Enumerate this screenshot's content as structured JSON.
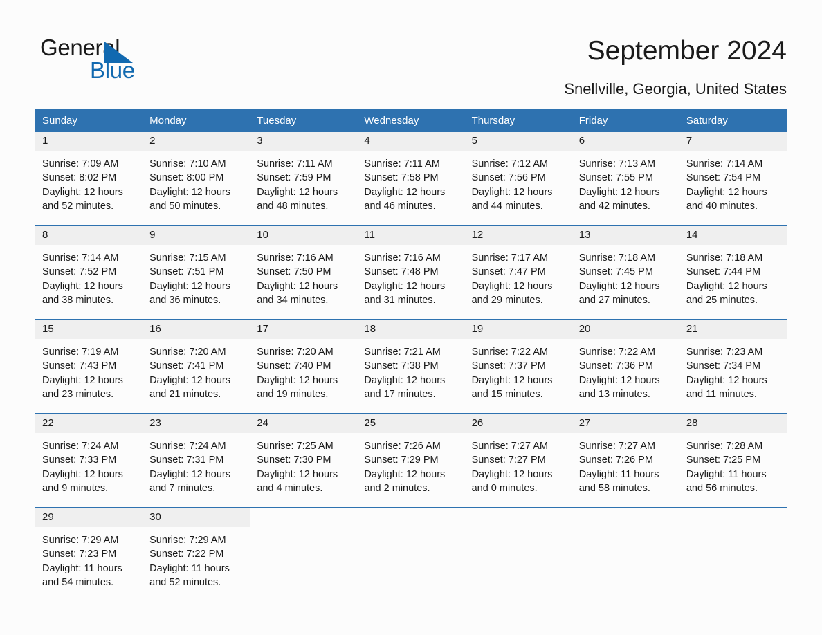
{
  "logo": {
    "word_one": "General",
    "word_two": "Blue",
    "triangle_color": "#1169b0",
    "text_color": "#1a1a1a"
  },
  "header": {
    "month_title": "September 2024",
    "location": "Snellville, Georgia, United States"
  },
  "theme": {
    "header_blue": "#2e72b0",
    "daynum_band": "#efefef",
    "page_background": "#fcfcfc",
    "text": "#1a1a1a"
  },
  "weekday_headers": [
    "Sunday",
    "Monday",
    "Tuesday",
    "Wednesday",
    "Thursday",
    "Friday",
    "Saturday"
  ],
  "weeks": [
    [
      {
        "day": "1",
        "sunrise": "Sunrise: 7:09 AM",
        "sunset": "Sunset: 8:02 PM",
        "daylight_line1": "Daylight: 12 hours",
        "daylight_line2": "and 52 minutes."
      },
      {
        "day": "2",
        "sunrise": "Sunrise: 7:10 AM",
        "sunset": "Sunset: 8:00 PM",
        "daylight_line1": "Daylight: 12 hours",
        "daylight_line2": "and 50 minutes."
      },
      {
        "day": "3",
        "sunrise": "Sunrise: 7:11 AM",
        "sunset": "Sunset: 7:59 PM",
        "daylight_line1": "Daylight: 12 hours",
        "daylight_line2": "and 48 minutes."
      },
      {
        "day": "4",
        "sunrise": "Sunrise: 7:11 AM",
        "sunset": "Sunset: 7:58 PM",
        "daylight_line1": "Daylight: 12 hours",
        "daylight_line2": "and 46 minutes."
      },
      {
        "day": "5",
        "sunrise": "Sunrise: 7:12 AM",
        "sunset": "Sunset: 7:56 PM",
        "daylight_line1": "Daylight: 12 hours",
        "daylight_line2": "and 44 minutes."
      },
      {
        "day": "6",
        "sunrise": "Sunrise: 7:13 AM",
        "sunset": "Sunset: 7:55 PM",
        "daylight_line1": "Daylight: 12 hours",
        "daylight_line2": "and 42 minutes."
      },
      {
        "day": "7",
        "sunrise": "Sunrise: 7:14 AM",
        "sunset": "Sunset: 7:54 PM",
        "daylight_line1": "Daylight: 12 hours",
        "daylight_line2": "and 40 minutes."
      }
    ],
    [
      {
        "day": "8",
        "sunrise": "Sunrise: 7:14 AM",
        "sunset": "Sunset: 7:52 PM",
        "daylight_line1": "Daylight: 12 hours",
        "daylight_line2": "and 38 minutes."
      },
      {
        "day": "9",
        "sunrise": "Sunrise: 7:15 AM",
        "sunset": "Sunset: 7:51 PM",
        "daylight_line1": "Daylight: 12 hours",
        "daylight_line2": "and 36 minutes."
      },
      {
        "day": "10",
        "sunrise": "Sunrise: 7:16 AM",
        "sunset": "Sunset: 7:50 PM",
        "daylight_line1": "Daylight: 12 hours",
        "daylight_line2": "and 34 minutes."
      },
      {
        "day": "11",
        "sunrise": "Sunrise: 7:16 AM",
        "sunset": "Sunset: 7:48 PM",
        "daylight_line1": "Daylight: 12 hours",
        "daylight_line2": "and 31 minutes."
      },
      {
        "day": "12",
        "sunrise": "Sunrise: 7:17 AM",
        "sunset": "Sunset: 7:47 PM",
        "daylight_line1": "Daylight: 12 hours",
        "daylight_line2": "and 29 minutes."
      },
      {
        "day": "13",
        "sunrise": "Sunrise: 7:18 AM",
        "sunset": "Sunset: 7:45 PM",
        "daylight_line1": "Daylight: 12 hours",
        "daylight_line2": "and 27 minutes."
      },
      {
        "day": "14",
        "sunrise": "Sunrise: 7:18 AM",
        "sunset": "Sunset: 7:44 PM",
        "daylight_line1": "Daylight: 12 hours",
        "daylight_line2": "and 25 minutes."
      }
    ],
    [
      {
        "day": "15",
        "sunrise": "Sunrise: 7:19 AM",
        "sunset": "Sunset: 7:43 PM",
        "daylight_line1": "Daylight: 12 hours",
        "daylight_line2": "and 23 minutes."
      },
      {
        "day": "16",
        "sunrise": "Sunrise: 7:20 AM",
        "sunset": "Sunset: 7:41 PM",
        "daylight_line1": "Daylight: 12 hours",
        "daylight_line2": "and 21 minutes."
      },
      {
        "day": "17",
        "sunrise": "Sunrise: 7:20 AM",
        "sunset": "Sunset: 7:40 PM",
        "daylight_line1": "Daylight: 12 hours",
        "daylight_line2": "and 19 minutes."
      },
      {
        "day": "18",
        "sunrise": "Sunrise: 7:21 AM",
        "sunset": "Sunset: 7:38 PM",
        "daylight_line1": "Daylight: 12 hours",
        "daylight_line2": "and 17 minutes."
      },
      {
        "day": "19",
        "sunrise": "Sunrise: 7:22 AM",
        "sunset": "Sunset: 7:37 PM",
        "daylight_line1": "Daylight: 12 hours",
        "daylight_line2": "and 15 minutes."
      },
      {
        "day": "20",
        "sunrise": "Sunrise: 7:22 AM",
        "sunset": "Sunset: 7:36 PM",
        "daylight_line1": "Daylight: 12 hours",
        "daylight_line2": "and 13 minutes."
      },
      {
        "day": "21",
        "sunrise": "Sunrise: 7:23 AM",
        "sunset": "Sunset: 7:34 PM",
        "daylight_line1": "Daylight: 12 hours",
        "daylight_line2": "and 11 minutes."
      }
    ],
    [
      {
        "day": "22",
        "sunrise": "Sunrise: 7:24 AM",
        "sunset": "Sunset: 7:33 PM",
        "daylight_line1": "Daylight: 12 hours",
        "daylight_line2": "and 9 minutes."
      },
      {
        "day": "23",
        "sunrise": "Sunrise: 7:24 AM",
        "sunset": "Sunset: 7:31 PM",
        "daylight_line1": "Daylight: 12 hours",
        "daylight_line2": "and 7 minutes."
      },
      {
        "day": "24",
        "sunrise": "Sunrise: 7:25 AM",
        "sunset": "Sunset: 7:30 PM",
        "daylight_line1": "Daylight: 12 hours",
        "daylight_line2": "and 4 minutes."
      },
      {
        "day": "25",
        "sunrise": "Sunrise: 7:26 AM",
        "sunset": "Sunset: 7:29 PM",
        "daylight_line1": "Daylight: 12 hours",
        "daylight_line2": "and 2 minutes."
      },
      {
        "day": "26",
        "sunrise": "Sunrise: 7:27 AM",
        "sunset": "Sunset: 7:27 PM",
        "daylight_line1": "Daylight: 12 hours",
        "daylight_line2": "and 0 minutes."
      },
      {
        "day": "27",
        "sunrise": "Sunrise: 7:27 AM",
        "sunset": "Sunset: 7:26 PM",
        "daylight_line1": "Daylight: 11 hours",
        "daylight_line2": "and 58 minutes."
      },
      {
        "day": "28",
        "sunrise": "Sunrise: 7:28 AM",
        "sunset": "Sunset: 7:25 PM",
        "daylight_line1": "Daylight: 11 hours",
        "daylight_line2": "and 56 minutes."
      }
    ],
    [
      {
        "day": "29",
        "sunrise": "Sunrise: 7:29 AM",
        "sunset": "Sunset: 7:23 PM",
        "daylight_line1": "Daylight: 11 hours",
        "daylight_line2": "and 54 minutes."
      },
      {
        "day": "30",
        "sunrise": "Sunrise: 7:29 AM",
        "sunset": "Sunset: 7:22 PM",
        "daylight_line1": "Daylight: 11 hours",
        "daylight_line2": "and 52 minutes."
      },
      {
        "day": "",
        "sunrise": "",
        "sunset": "",
        "daylight_line1": "",
        "daylight_line2": ""
      },
      {
        "day": "",
        "sunrise": "",
        "sunset": "",
        "daylight_line1": "",
        "daylight_line2": ""
      },
      {
        "day": "",
        "sunrise": "",
        "sunset": "",
        "daylight_line1": "",
        "daylight_line2": ""
      },
      {
        "day": "",
        "sunrise": "",
        "sunset": "",
        "daylight_line1": "",
        "daylight_line2": ""
      },
      {
        "day": "",
        "sunrise": "",
        "sunset": "",
        "daylight_line1": "",
        "daylight_line2": ""
      }
    ]
  ]
}
